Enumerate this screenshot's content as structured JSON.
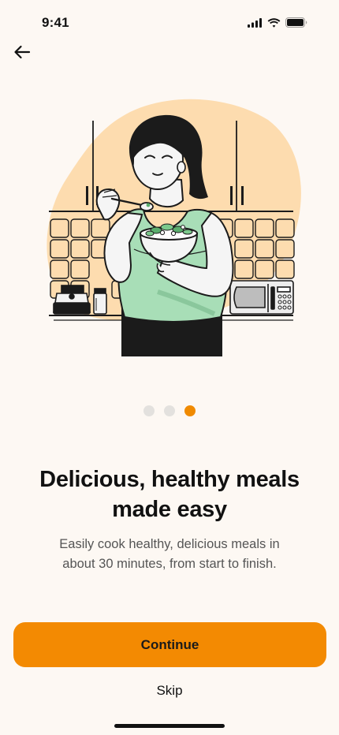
{
  "status_bar": {
    "time": "9:41",
    "icons": [
      "signal-icon",
      "wifi-icon",
      "battery-icon"
    ]
  },
  "navigation": {
    "back_icon": "arrow-left-icon"
  },
  "illustration": {
    "description_icon": "woman-eating-salad-illustration"
  },
  "pagination": {
    "total": 3,
    "active_index": 2
  },
  "content": {
    "title_line1": "Delicious, healthy meals",
    "title_line2": "made easy",
    "body_line1": "Easily cook healthy, delicious meals in",
    "body_line2": "about 30 minutes, from start to finish."
  },
  "actions": {
    "continue_label": "Continue",
    "skip_label": "Skip"
  },
  "colors": {
    "background": "#FDF8F3",
    "accent": "#F38A02",
    "blob": "#FDDCAF",
    "shirt": "#A8DEB7",
    "dot_inactive": "#E3E1DE"
  }
}
